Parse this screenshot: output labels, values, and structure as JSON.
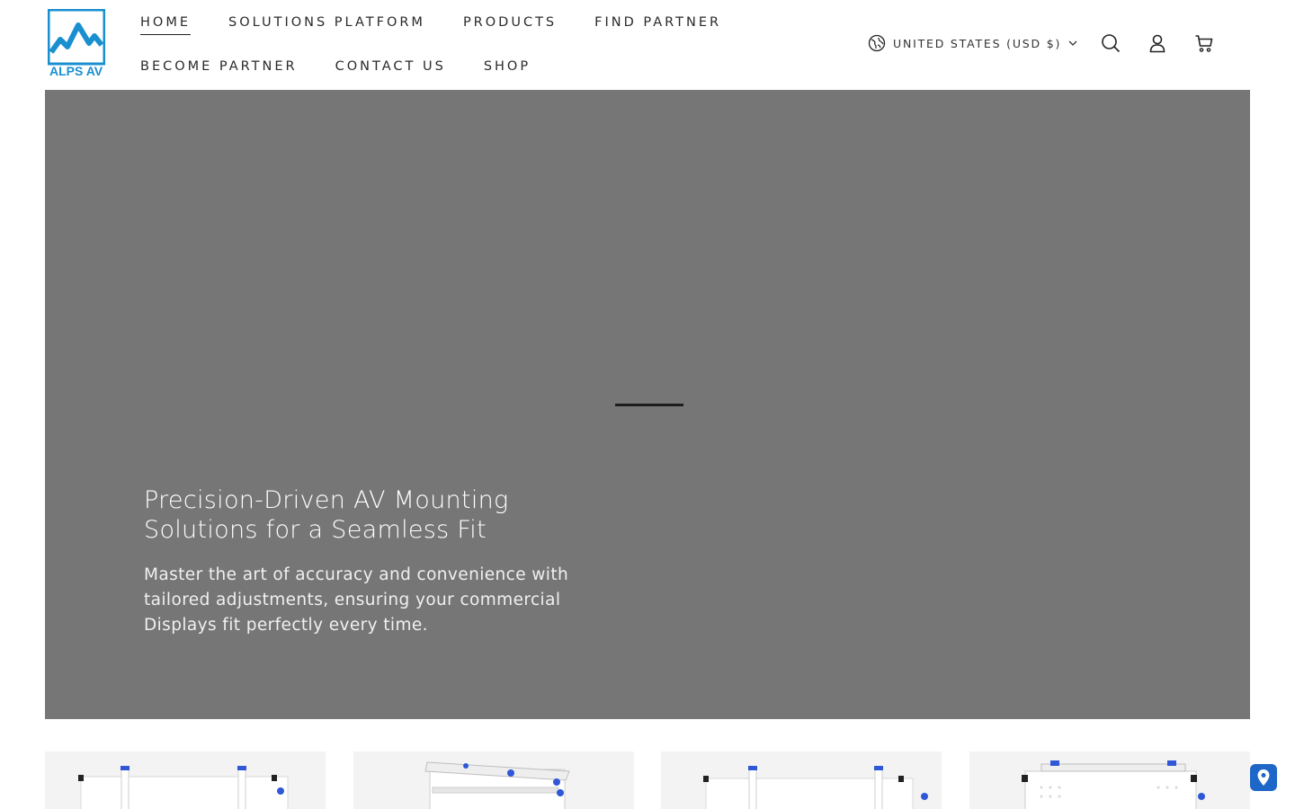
{
  "brand": {
    "logo_text": "ALPS AV",
    "accent": "#1a8fd0"
  },
  "nav": {
    "row1": [
      {
        "label": "HOME",
        "active": true
      },
      {
        "label": "SOLUTIONS PLATFORM"
      },
      {
        "label": "PRODUCTS"
      },
      {
        "label": "FIND PARTNER"
      }
    ],
    "row2": [
      {
        "label": "BECOME PARTNER"
      },
      {
        "label": "CONTACT US"
      },
      {
        "label": "SHOP"
      }
    ]
  },
  "header_tools": {
    "country_label": "UNITED STATES (USD $)",
    "icons": [
      "globe-icon",
      "search-icon",
      "account-icon",
      "cart-icon"
    ]
  },
  "hero": {
    "title": "Precision-Driven AV Mounting Solutions for a Seamless Fit",
    "subtitle": "Master the art of accuracy and convenience with tailored adjustments, ensuring your commercial Displays fit perfectly every time.",
    "background": "#767676"
  },
  "locator_color": "#1e66c8"
}
